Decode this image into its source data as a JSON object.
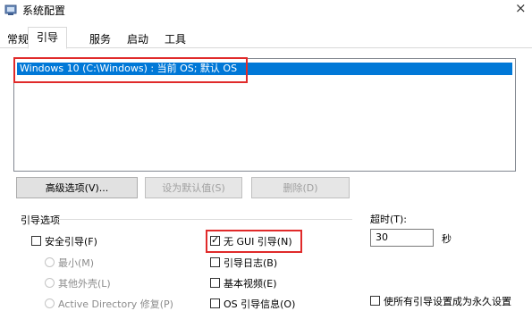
{
  "window": {
    "title": "系统配置",
    "close_glyph": "×"
  },
  "tabs": [
    {
      "label": "常规"
    },
    {
      "label": "引导",
      "active": true
    },
    {
      "label": "服务"
    },
    {
      "label": "启动"
    },
    {
      "label": "工具"
    }
  ],
  "os_list": {
    "items": [
      "Windows 10 (C:\\Windows) : 当前 OS; 默认 OS"
    ]
  },
  "buttons": {
    "advanced": "高级选项(V)...",
    "set_default": "设为默认值(S)",
    "delete": "删除(D)"
  },
  "boot_options": {
    "group_label": "引导选项",
    "safe_boot": {
      "label": "安全引导(F)",
      "checked": false
    },
    "minimal": "最小(M)",
    "alternate_shell": "其他外壳(L)",
    "active_directory": "Active Directory 修复(P)",
    "no_gui_boot": {
      "label": "无 GUI 引导(N)",
      "checked": true
    },
    "boot_log": {
      "label": "引导日志(B)",
      "checked": false
    },
    "base_video": {
      "label": "基本视频(E)",
      "checked": false
    },
    "os_boot_info": {
      "label": "OS 引导信息(O)",
      "checked": false
    }
  },
  "timeout": {
    "label": "超时(T):",
    "value": "30",
    "unit": "秒"
  },
  "make_permanent": {
    "label": "使所有引导设置成为永久设置",
    "checked": false
  },
  "colors": {
    "accent": "#0078d7",
    "highlight_red": "#e02a2a"
  }
}
